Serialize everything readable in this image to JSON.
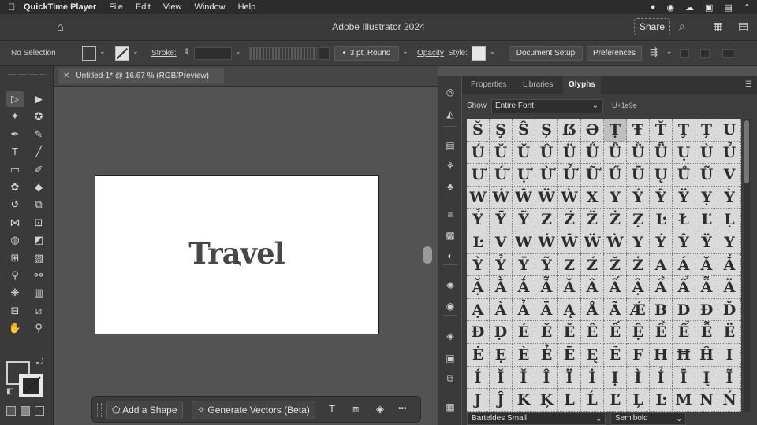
{
  "menubar": {
    "apple": "",
    "app": "QuickTime Player",
    "items": [
      "File",
      "Edit",
      "View",
      "Window",
      "Help"
    ],
    "tray": [
      "●",
      "◉",
      "☁",
      "▣",
      "▤",
      "⌃"
    ]
  },
  "titlebar": {
    "title": "Adobe Illustrator 2024",
    "share": "Share",
    "home_icon": "⌂",
    "search_icon": "⌕",
    "grid_icon": "▦",
    "panels_icon": "▤"
  },
  "control": {
    "selection": "No Selection",
    "stroke_label": "Stroke:",
    "brush": "3 pt. Round",
    "brush_dot": "•",
    "opacity_label": "Opacity",
    "style_label": "Style:",
    "doc_setup": "Document Setup",
    "preferences": "Preferences",
    "chevron": "⌄",
    "spinner": "⇕",
    "arrange_icon": "⇶"
  },
  "doc": {
    "tab_title": "Untitled-1* @ 16.67 % (RGB/Preview)",
    "close": "✕",
    "art_text": "Travel",
    "cursor": "↖"
  },
  "tools": [
    {
      "name": "selection-tool-icon",
      "g": "▷"
    },
    {
      "name": "direct-selection-tool-icon",
      "g": "▶"
    },
    {
      "name": "magic-wand-tool-icon",
      "g": "✦"
    },
    {
      "name": "lasso-tool-icon",
      "g": "✪"
    },
    {
      "name": "pen-tool-icon",
      "g": "✒"
    },
    {
      "name": "curvature-tool-icon",
      "g": "✎"
    },
    {
      "name": "type-tool-icon",
      "g": "T"
    },
    {
      "name": "line-tool-icon",
      "g": "╱"
    },
    {
      "name": "rectangle-tool-icon",
      "g": "▭"
    },
    {
      "name": "paintbrush-tool-icon",
      "g": "✐"
    },
    {
      "name": "shaper-tool-icon",
      "g": "✿"
    },
    {
      "name": "eraser-tool-icon",
      "g": "◆"
    },
    {
      "name": "rotate-tool-icon",
      "g": "↺"
    },
    {
      "name": "scale-tool-icon",
      "g": "⧉"
    },
    {
      "name": "width-tool-icon",
      "g": "⋈"
    },
    {
      "name": "free-transform-tool-icon",
      "g": "⊡"
    },
    {
      "name": "shape-builder-tool-icon",
      "g": "◍"
    },
    {
      "name": "perspective-grid-tool-icon",
      "g": "◩"
    },
    {
      "name": "mesh-tool-icon",
      "g": "⊞"
    },
    {
      "name": "gradient-tool-icon",
      "g": "▨"
    },
    {
      "name": "eyedropper-tool-icon",
      "g": "⚲"
    },
    {
      "name": "blend-tool-icon",
      "g": "⚯"
    },
    {
      "name": "symbol-sprayer-tool-icon",
      "g": "❋"
    },
    {
      "name": "column-graph-tool-icon",
      "g": "▥"
    },
    {
      "name": "artboard-tool-icon",
      "g": "⊟"
    },
    {
      "name": "slice-tool-icon",
      "g": "⧄"
    },
    {
      "name": "hand-tool-icon",
      "g": "✋"
    },
    {
      "name": "zoom-tool-icon",
      "g": "⚲"
    }
  ],
  "fill_stroke": {
    "swap": "⤾",
    "default": "◧"
  },
  "ctxbar": {
    "add_shape": "Add a Shape",
    "add_shape_icon": "⬠",
    "generate": "Generate Vectors (Beta)",
    "generate_icon": "✧",
    "type_icon": "T",
    "crop_icon": "⧈",
    "recolor_icon": "◈",
    "more": "•••"
  },
  "strip_icons": [
    "◎",
    "◭",
    "▤",
    "⚘",
    "♣",
    "≡",
    "▩",
    "◐",
    "✺",
    "◉",
    "◈",
    "▣",
    "⧉",
    "▦"
  ],
  "panel": {
    "tabs": [
      "Properties",
      "Libraries",
      "Glyphs"
    ],
    "active_tab": 2,
    "menu": "☰",
    "show_label": "Show",
    "show_value": "Entire Font",
    "unicode": "U+1e9e",
    "font_family": "Barteldes Small",
    "font_style": "Semibold",
    "chevron": "⌄"
  },
  "glyphs": [
    [
      "Š",
      "Ş",
      "Ŝ",
      "Ș",
      "ẞ",
      "Ə",
      "Ṭ",
      "Ŧ",
      "Ť",
      "Ţ",
      "Ț",
      "U"
    ],
    [
      "Ú",
      "Ŭ",
      "Ǔ",
      "Û",
      "Ü",
      "Ǘ",
      "Ǚ",
      "Ǜ",
      "Ǖ",
      "Ụ",
      "Ù",
      "Ủ"
    ],
    [
      "Ư",
      "Ứ",
      "Ự",
      "Ừ",
      "Ử",
      "Ữ",
      "Ű",
      "Ū",
      "Ų",
      "Ů",
      "Ũ",
      "V"
    ],
    [
      "W",
      "Ẃ",
      "Ŵ",
      "Ẅ",
      "Ẁ",
      "X",
      "Y",
      "Ý",
      "Ŷ",
      "Ÿ",
      "Ỵ",
      "Ỳ"
    ],
    [
      "Ỷ",
      "Ȳ",
      "Ỹ",
      "Z",
      "Ź",
      "Ž",
      "Ż",
      "Ẓ",
      "Ŀ",
      "Ł",
      "Ľ",
      "Ḷ"
    ],
    [
      "Ŀ",
      "V",
      "W",
      "Ẃ",
      "Ŵ",
      "Ẅ",
      "Ẁ",
      "Y",
      "Ý",
      "Ŷ",
      "Ÿ",
      "Y"
    ],
    [
      "Ỳ",
      "Ỷ",
      "Ȳ",
      "Ỹ",
      "Z",
      "Ź",
      "Ž",
      "Ż",
      "A",
      "Á",
      "Ă",
      "Ắ"
    ],
    [
      "Ặ",
      "Ằ",
      "Ẳ",
      "Ẵ",
      "Ǎ",
      "Â",
      "Ấ",
      "Ậ",
      "Ầ",
      "Ẩ",
      "Ẫ",
      "Ä"
    ],
    [
      "Ạ",
      "À",
      "Ả",
      "Ā",
      "Ą",
      "Å",
      "Ã",
      "Ǽ",
      "B",
      "D",
      "Đ",
      "Ď"
    ],
    [
      "Ð",
      "Ḍ",
      "É",
      "Ĕ",
      "Ě",
      "Ê",
      "Ế",
      "Ệ",
      "Ề",
      "Ể",
      "Ễ",
      "Ë"
    ],
    [
      "Ė",
      "Ẹ",
      "È",
      "Ẻ",
      "Ē",
      "Ę",
      "Ẽ",
      "F",
      "H",
      "Ħ",
      "Ĥ",
      "I"
    ],
    [
      "Í",
      "Ĭ",
      "Ǐ",
      "Î",
      "Ï",
      "İ",
      "Ị",
      "Ì",
      "Ỉ",
      "Ī",
      "Į",
      "Ĩ"
    ],
    [
      "J",
      "Ĵ",
      "K",
      "Ķ",
      "L",
      "Ĺ",
      "Ľ",
      "Ļ",
      "Ŀ",
      "M",
      "N",
      "Ń"
    ]
  ],
  "selected_glyph": {
    "row": 0,
    "col": 6
  },
  "colors": {
    "ui_dark": "#3a3a3a",
    "canvas": "#535353",
    "glyph_bg": "#d9d9d9"
  }
}
